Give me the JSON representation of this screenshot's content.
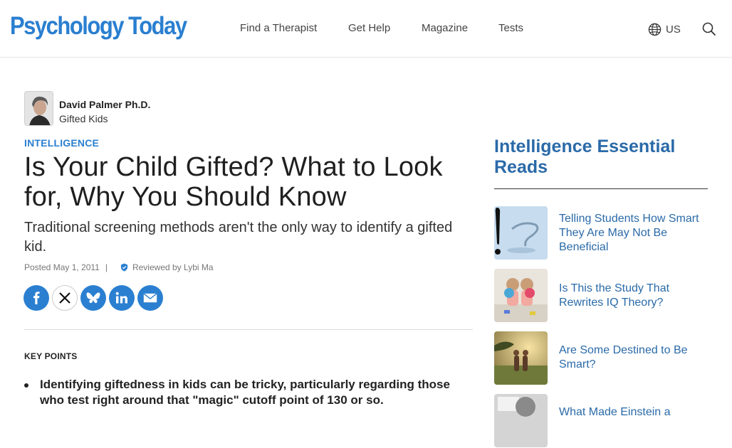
{
  "header": {
    "logo": "Psychology Today",
    "nav": [
      "Find a Therapist",
      "Get Help",
      "Magazine",
      "Tests"
    ],
    "region": "US",
    "icons": {
      "region": "globe-icon",
      "search": "search-icon"
    }
  },
  "article": {
    "author_name": "David Palmer Ph.D.",
    "author_blog": "Gifted Kids",
    "category": "INTELLIGENCE",
    "title": "Is Your Child Gifted? What to Look for, Why You Should Know",
    "subtitle": "Traditional screening methods aren't the only way to identify a gifted kid.",
    "posted": "Posted May 1, 2011",
    "separator": "|",
    "reviewed": "Reviewed by Lybi Ma",
    "share_icons": [
      "facebook-icon",
      "x-icon",
      "bluesky-icon",
      "linkedin-icon",
      "email-icon"
    ],
    "key_points_label": "KEY POINTS",
    "key_points": [
      "Identifying giftedness in kids can be tricky, particularly regarding those who test right around that \"magic\" cutoff point of 130 or so."
    ]
  },
  "sidebar": {
    "title": "Intelligence Essential Reads",
    "reads": [
      "Telling Students How Smart They Are May Not Be Beneficial",
      "Is This the Study That Rewrites IQ Theory?",
      "Are Some Destined to Be Smart?",
      "What Made Einstein a"
    ]
  },
  "colors": {
    "brand_blue": "#2a7fd0",
    "sidebar_blue": "#2a6aa8"
  }
}
